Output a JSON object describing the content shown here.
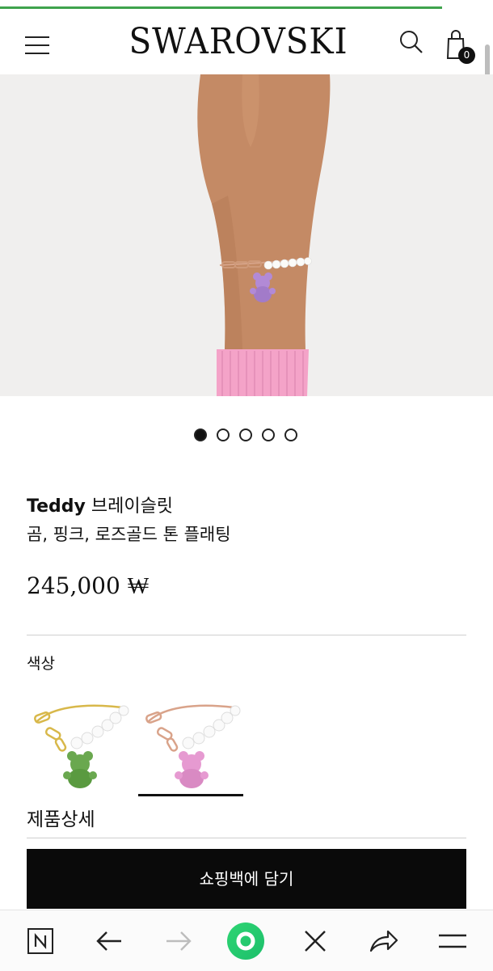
{
  "header": {
    "brand": "SWAROVSKI",
    "menu_icon": "hamburger-menu-icon",
    "search_icon": "search-icon",
    "bag_icon": "shopping-bag-icon",
    "bag_count": "0"
  },
  "gallery": {
    "image_count": 5,
    "active_index": 0
  },
  "product": {
    "name_bold": "Teddy",
    "name_rest": "브레이슬릿",
    "variant": "곰, 핑크, 로즈골드 톤 플래팅",
    "price": "245,000 ₩"
  },
  "colors": {
    "label": "색상",
    "options": [
      {
        "name": "green",
        "selected": false
      },
      {
        "name": "pink",
        "selected": true
      }
    ]
  },
  "details": {
    "label": "제품상세"
  },
  "cta": {
    "label": "쇼핑백에 담기"
  },
  "browser_bar": {
    "icons": [
      "naver-n-icon",
      "back-arrow-icon",
      "forward-arrow-icon",
      "home-circle-icon",
      "close-icon",
      "share-icon",
      "menu-icon"
    ]
  },
  "colors_theme": {
    "progress": "#3fa34d",
    "sleeve": "#f4a3c8",
    "cta_bg": "#0a0a0a"
  }
}
